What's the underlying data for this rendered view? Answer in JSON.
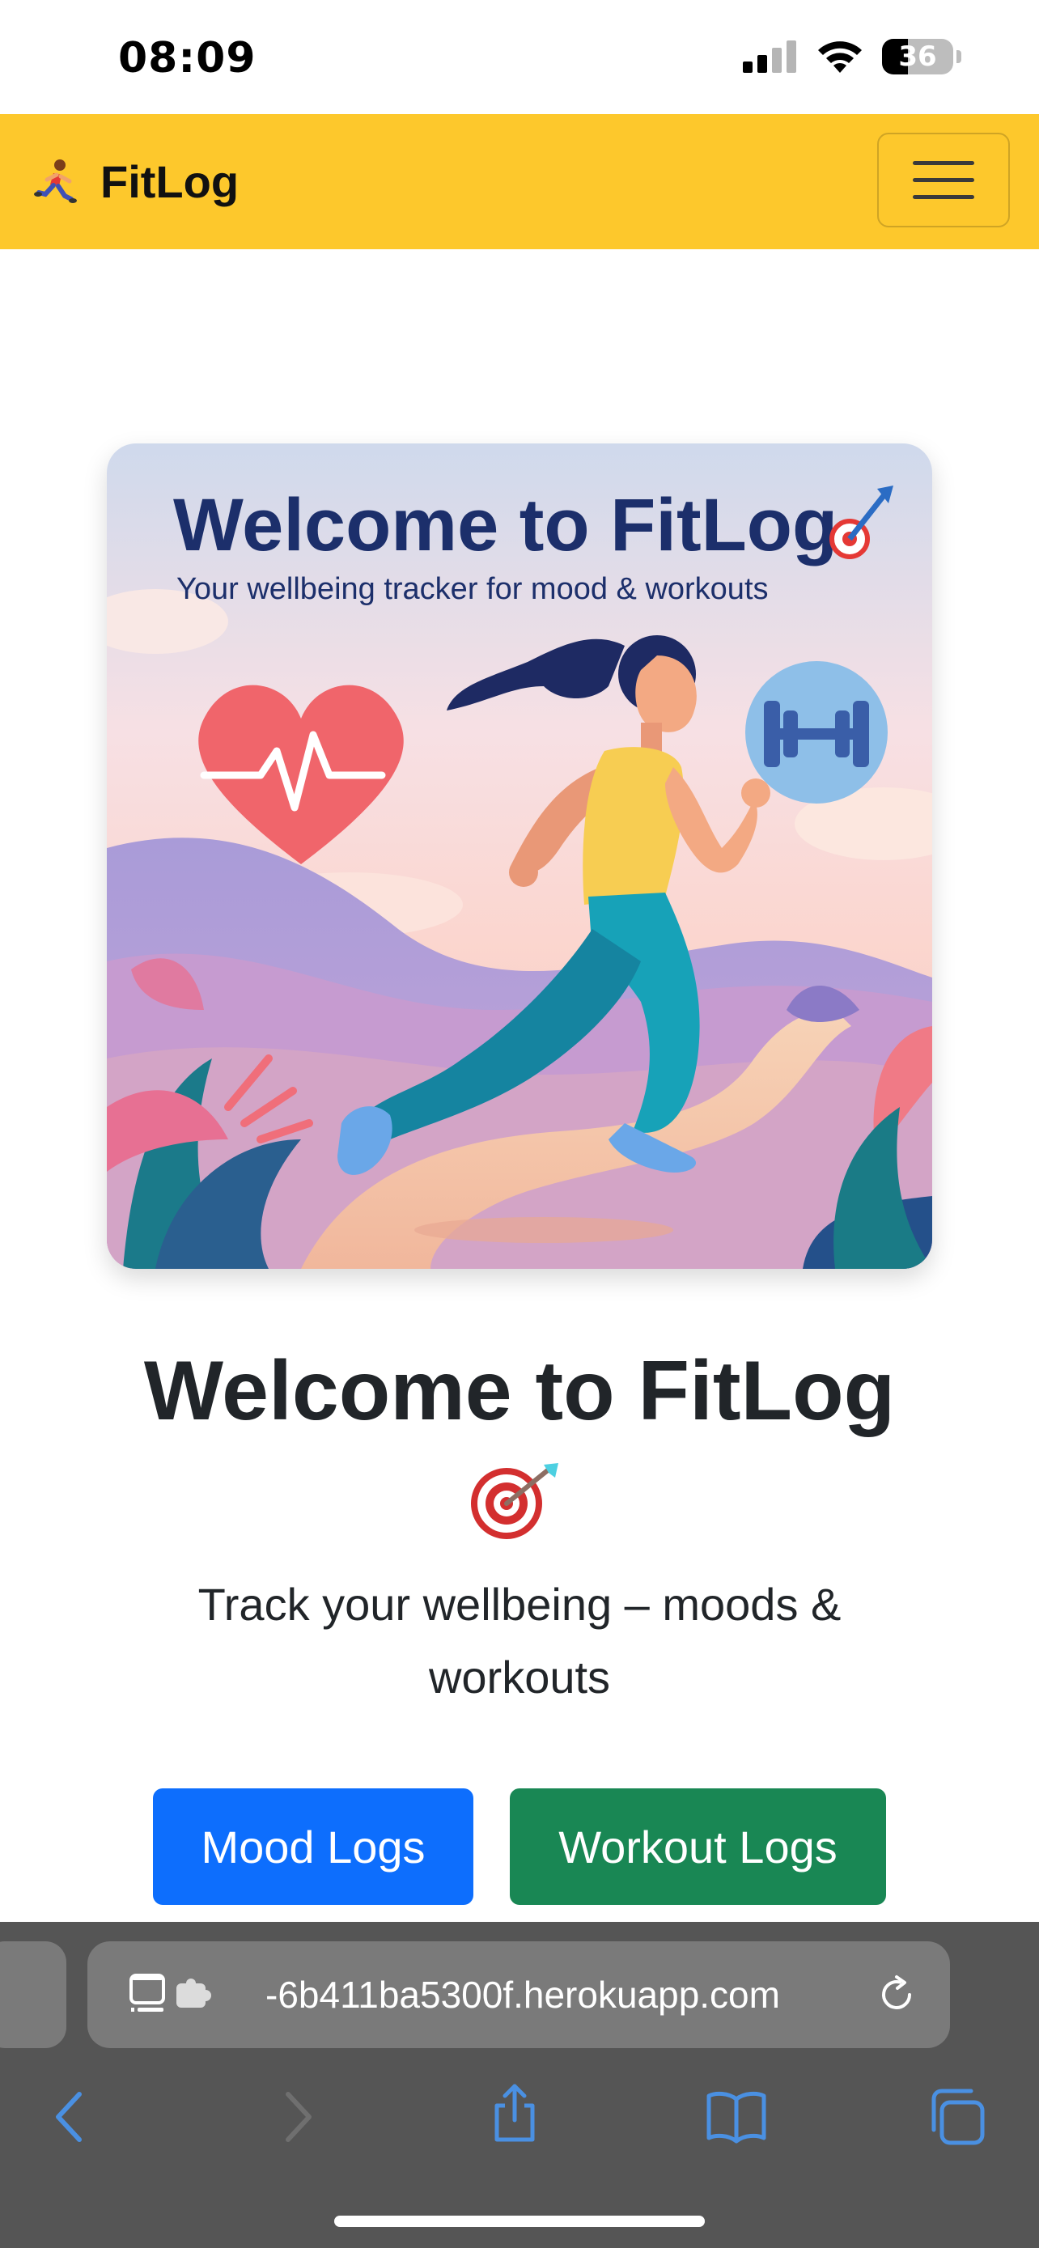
{
  "status_bar": {
    "time": "08:09",
    "battery_level": "36",
    "battery_fraction": 0.36
  },
  "navbar": {
    "brand": "FitLog",
    "brand_icon": "runner-icon",
    "menu_icon": "hamburger-icon"
  },
  "hero_image": {
    "title": "Welcome to FitLog",
    "subtitle": "Your wellbeing tracker for mood & workouts"
  },
  "main": {
    "headline": "Welcome to FitLog",
    "headline_icon": "target-dart-icon",
    "tagline": "Track your wellbeing – moods & workouts"
  },
  "buttons": {
    "mood_logs": "Mood Logs",
    "workout_logs": "Workout Logs"
  },
  "browser": {
    "url": "-6b411ba5300f.herokuapp.com",
    "icons": [
      "reader-icon",
      "extension-icon",
      "reload-icon",
      "back-icon",
      "forward-icon",
      "share-icon",
      "bookmarks-icon",
      "tabs-icon"
    ]
  },
  "colors": {
    "navbar": "#fdc82c",
    "mood_button": "#0d6efd",
    "workout_button": "#198754",
    "text": "#212529"
  }
}
